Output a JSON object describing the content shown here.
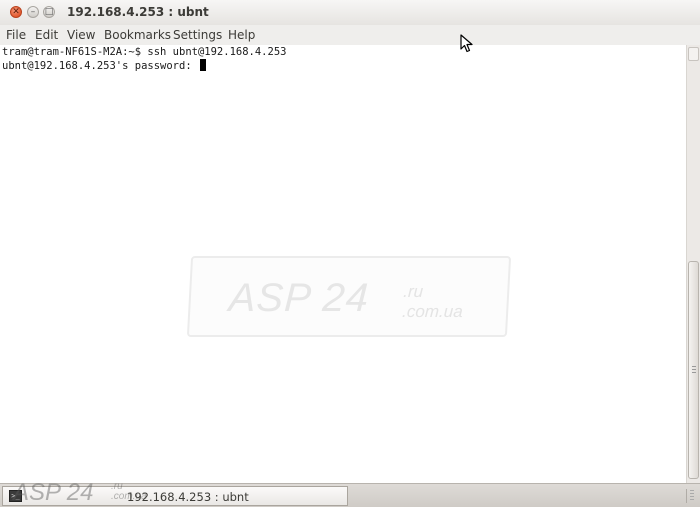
{
  "window": {
    "title": "192.168.4.253 : ubnt",
    "controls": {
      "close_glyph": "✕",
      "minimize_glyph": "–",
      "maximize_glyph": "□"
    }
  },
  "menubar": {
    "items": [
      "File",
      "Edit",
      "View",
      "Bookmarks",
      "Settings",
      "Help"
    ]
  },
  "terminal": {
    "lines": [
      "tram@tram-NF61S-M2A:~$ ssh ubnt@192.168.4.253",
      "ubnt@192.168.4.253's password: "
    ]
  },
  "watermark": {
    "brand": "ASP 24",
    "domain_ru": ".ru",
    "domain_ua": ".com.ua"
  },
  "taskbar": {
    "window_button_label": "192.168.4.253 : ubnt",
    "icon": "terminal-icon"
  },
  "colors": {
    "close_button": "#e35a2f",
    "titlebar": "#ece9e6",
    "terminal_bg": "#ffffff",
    "terminal_fg": "#1a1a1a"
  }
}
